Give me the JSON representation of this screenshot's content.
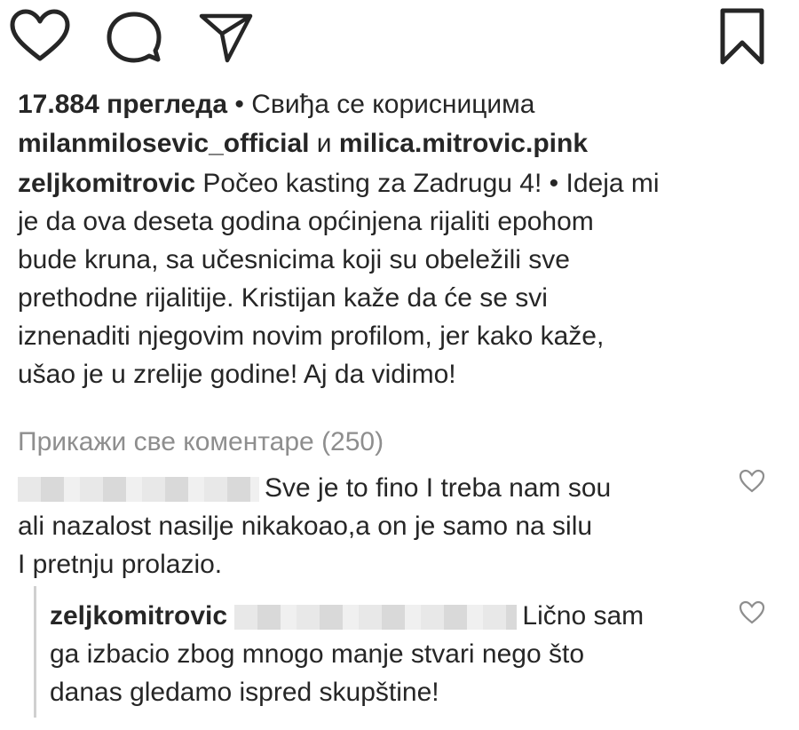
{
  "actions": {
    "like_icon": "heart-icon",
    "comment_icon": "comment-bubble-icon",
    "share_icon": "paper-plane-icon",
    "save_icon": "bookmark-icon"
  },
  "stats": {
    "views": "17.884 прегледа",
    "liked_by_prefix": " • Свиђа се корисницима",
    "liker_1": "milanmilosevic_official",
    "conjunction": " и ",
    "liker_2": "milica.mitrovic.pink"
  },
  "caption": {
    "username": "zeljkomitrovic",
    "line1": " Počeo kasting za Zadrugu 4! • Ideja mi",
    "line2": "je da ova deseta godina općinjena rijaliti epohom",
    "line3": "bude kruna, sa učesnicima koji su obeležili sve",
    "line4": "prethodne rijalitije. Kristijan kaže da će se svi",
    "line5": "iznenaditi njegovim novim profilom, jer kako kaže,",
    "line6": "ušao je u zrelije godine! Aj da vidimo!"
  },
  "view_all_comments": "Прикажи све коментаре (250)",
  "comments": [
    {
      "line1": "Sve je to fino I treba nam sou",
      "line2": "ali nazalost nasilje nikakoao,a on je samo na silu",
      "line3": "I pretnju prolazio."
    }
  ],
  "replies": [
    {
      "username": "zeljkomitrovic",
      "line1": "Lično sam",
      "line2": "ga izbacio zbog mnogo manje stvari nego što",
      "line3": "danas gledamo ispred skupštine!"
    }
  ],
  "colors": {
    "text": "#262626",
    "muted": "#8e8e8e"
  }
}
